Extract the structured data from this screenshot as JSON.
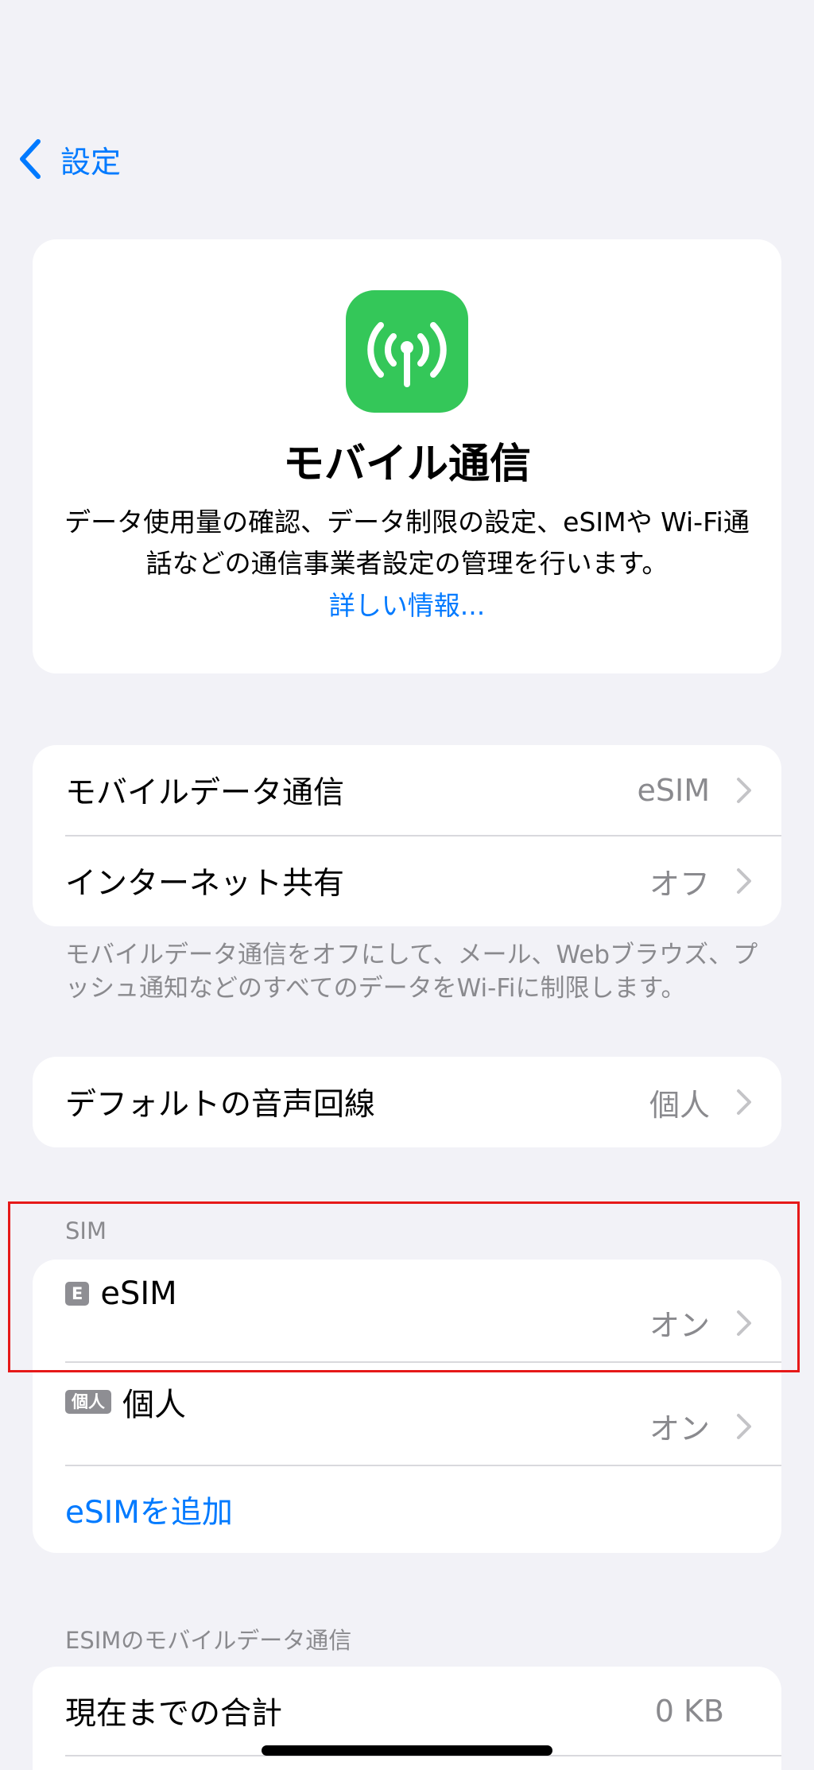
{
  "nav": {
    "back_label": "設定"
  },
  "header": {
    "icon": "antenna-radiowaves-icon",
    "title": "モバイル通信",
    "description": "データ使用量の確認、データ制限の設定、eSIMや Wi-Fi通話などの通信事業者設定の管理を行います。",
    "link": "詳しい情報..."
  },
  "group1": {
    "rows": [
      {
        "label": "モバイルデータ通信",
        "value": "eSIM"
      },
      {
        "label": "インターネット共有",
        "value": "オフ"
      }
    ],
    "footer": "モバイルデータ通信をオフにして、メール、Webブラウズ、プッシュ通知などのすべてのデータをWi-Fiに制限します。"
  },
  "group2": {
    "rows": [
      {
        "label": "デフォルトの音声回線",
        "value": "個人"
      }
    ]
  },
  "sim_section": {
    "header": "SIM",
    "lines": [
      {
        "badge": "E",
        "name": "eSIM",
        "value": "オン"
      },
      {
        "badge": "個人",
        "name": "個人",
        "value": "オン"
      }
    ],
    "add_label": "eSIMを追加"
  },
  "usage_section": {
    "header": "ESIMのモバイルデータ通信",
    "rows": [
      {
        "label": "現在までの合計",
        "value": "0 KB"
      }
    ]
  },
  "colors": {
    "accent": "#007aff",
    "icon_green": "#34c759",
    "highlight": "#e61919"
  }
}
